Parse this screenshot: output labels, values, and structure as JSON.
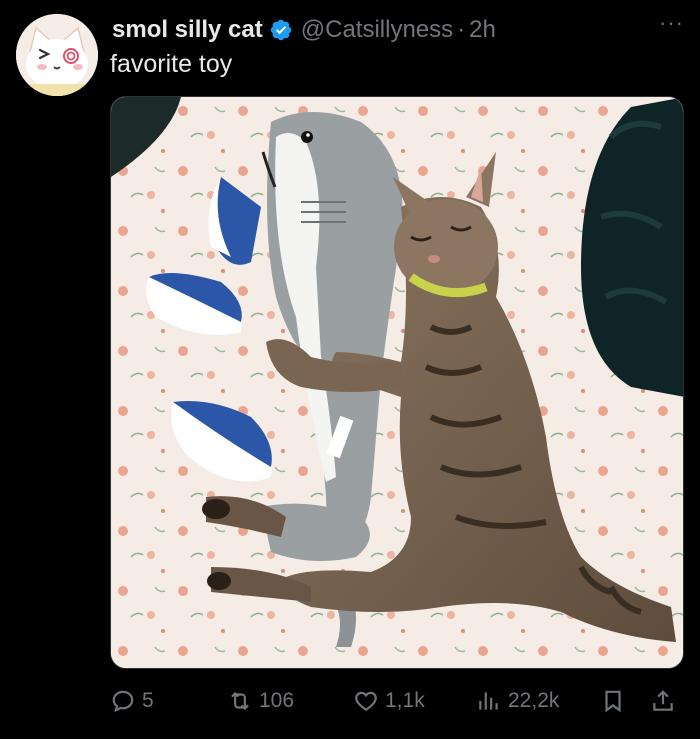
{
  "tweet": {
    "display_name": "smol silly cat",
    "handle": "@Catsillyness",
    "separator": "·",
    "time": "2h",
    "text": "favorite toy",
    "more": "···"
  },
  "actions": {
    "replies": "5",
    "retweets": "106",
    "likes": "1,1k",
    "views": "22,2k"
  },
  "icons": {
    "reply": "reply-icon",
    "retweet": "retweet-icon",
    "like": "heart-icon",
    "views": "views-icon",
    "bookmark": "bookmark-icon",
    "share": "share-icon",
    "verified": "verified-badge-icon"
  },
  "colors": {
    "background": "#000000",
    "text": "#e7e9ea",
    "muted": "#71767b",
    "verified": "#1d9bf0"
  }
}
